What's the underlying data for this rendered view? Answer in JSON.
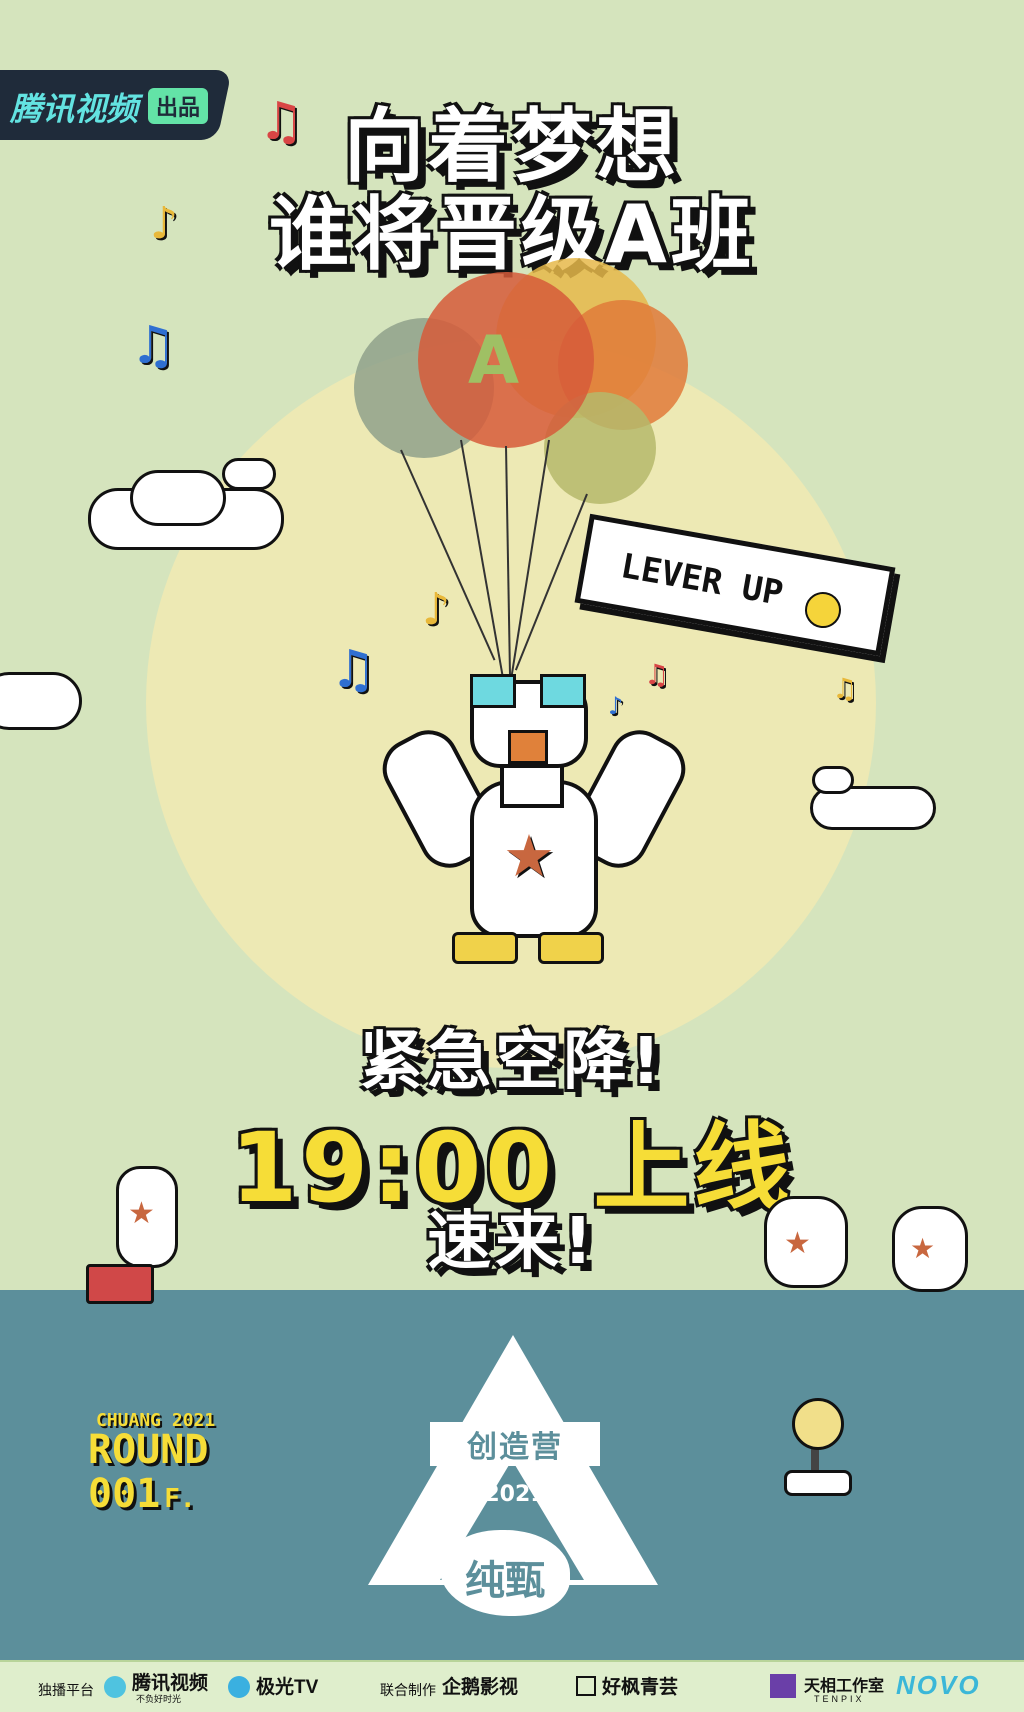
{
  "brand": {
    "name": "腾讯视频",
    "badge": "出品"
  },
  "headline": {
    "line1": "向着梦想",
    "line2": "谁将晋级A班"
  },
  "balloon_letter": "A",
  "speech_bubble": "LEVER UP",
  "cta": {
    "line1": "紧急空降!",
    "line2": "19:00 上线",
    "line3": "速来!"
  },
  "round_badge": {
    "sub": "CHUANG 2021",
    "main1": "ROUND",
    "main2": "001",
    "suffix": "F."
  },
  "logo": {
    "name": "创造营",
    "year": "2021",
    "sponsor": "纯甄",
    "reg": "®"
  },
  "footer": {
    "exclusive_label": "独播平台",
    "platform1": "腾讯视频",
    "platform1_sub": "不负好时光",
    "platform2": "极光TV",
    "coprod_label": "联合制作",
    "coprod1": "企鹅影视",
    "coprod2": "好枫青芸",
    "studio": "天相工作室",
    "studio_sub": "TENPIX",
    "partner": "NOVO"
  },
  "colors": {
    "sky": "#d5e4bd",
    "sun": "#ede9b4",
    "ground": "#5c8f9b",
    "accent_yellow": "#f6dd37",
    "balloon_red": "#d65a3a",
    "balloon_orange": "#e07a3a",
    "balloon_grey": "#8fa18b",
    "balloon_olive": "#b5b86b",
    "balloon_yellow": "#e6b84a"
  },
  "icons": [
    "music-note-icon",
    "cloud-icon",
    "star-icon",
    "smile-icon",
    "joystick-icon",
    "radio-icon"
  ]
}
